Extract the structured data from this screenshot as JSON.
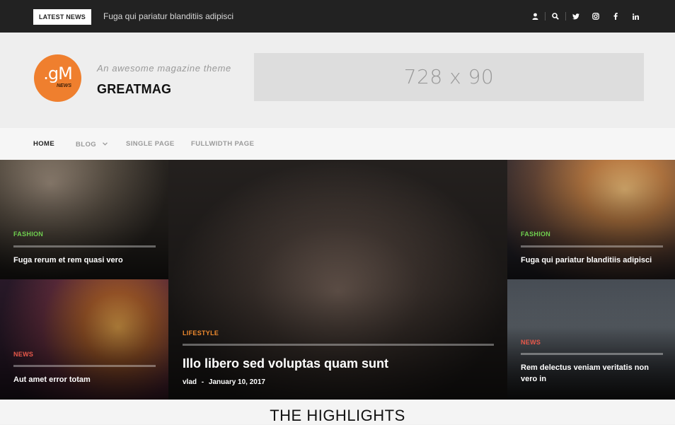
{
  "topbar": {
    "latest_label": "LATEST NEWS",
    "latest_title": "Fuga qui pariatur blanditiis adipisci",
    "icons": [
      "user-icon",
      "search-icon",
      "twitter-icon",
      "instagram-icon",
      "facebook-icon",
      "linkedin-icon"
    ]
  },
  "header": {
    "logo_main": ".gM",
    "logo_sub": "NEWS",
    "tagline": "An awesome magazine theme",
    "site_title": "GREATMAG",
    "ad_text": "728 x 90"
  },
  "nav": {
    "items": [
      {
        "label": "HOME",
        "active": true
      },
      {
        "label": "BLOG",
        "has_dropdown": true
      },
      {
        "label": "SINGLE PAGE"
      },
      {
        "label": "FULLWIDTH PAGE"
      }
    ]
  },
  "posts": [
    {
      "category": "FASHION",
      "category_color": "#6fcf4f",
      "title": "Fuga rerum et rem quasi vero"
    },
    {
      "category": "NEWS",
      "category_color": "#e8584a",
      "title": "Aut amet error totam"
    },
    {
      "category": "LIFESTYLE",
      "category_color": "#ef8a2e",
      "title": "Illo libero sed voluptas quam sunt",
      "author": "vlad",
      "separator": "-",
      "date": "January 10, 2017"
    },
    {
      "category": "FASHION",
      "category_color": "#6fcf4f",
      "title": "Fuga qui pariatur blanditiis adipisci"
    },
    {
      "category": "NEWS",
      "category_color": "#e8584a",
      "title": "Rem delectus veniam veritatis non vero in"
    }
  ],
  "section": {
    "highlights_title": "THE HIGHLIGHTS"
  },
  "colors": {
    "topbar_bg": "#222222",
    "accent_orange": "#ef7f2e",
    "fashion_green": "#6fcf4f",
    "news_red": "#e8584a"
  }
}
